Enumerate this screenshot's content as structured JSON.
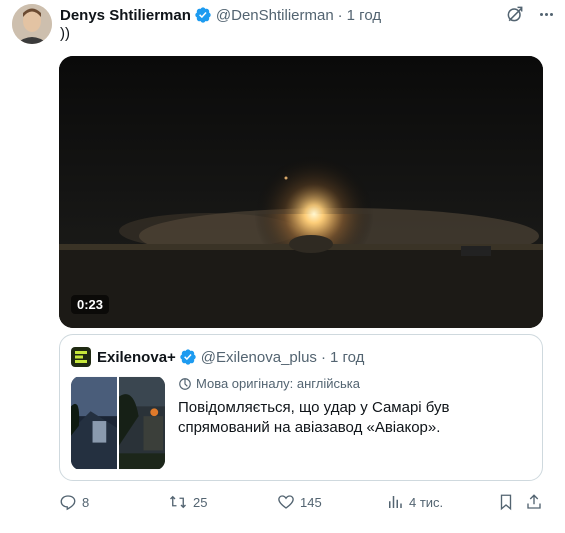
{
  "author": {
    "name": "Denys Shtilierman",
    "handle": "@DenShtilierman",
    "separator": "·",
    "time": "1 год",
    "verified_color": "#1d9bf0"
  },
  "tweet": {
    "text": "))"
  },
  "video": {
    "duration": "0:23"
  },
  "quote": {
    "name": "Exilenova+",
    "handle": "@Exilenova_plus",
    "separator": "·",
    "time": "1 год",
    "lang_note": "Мова оригіналу: англійська",
    "text": "Повідомляється, що удар у Самарі був спрямований на авіазавод «Авіакор»."
  },
  "actions": {
    "replies": "8",
    "reposts": "25",
    "likes": "145",
    "views": "4 тис."
  },
  "icons": [
    "verified-icon",
    "grok-icon",
    "more-icon",
    "translate-icon",
    "reply-icon",
    "repost-icon",
    "like-icon",
    "views-icon",
    "bookmark-icon",
    "share-icon"
  ]
}
